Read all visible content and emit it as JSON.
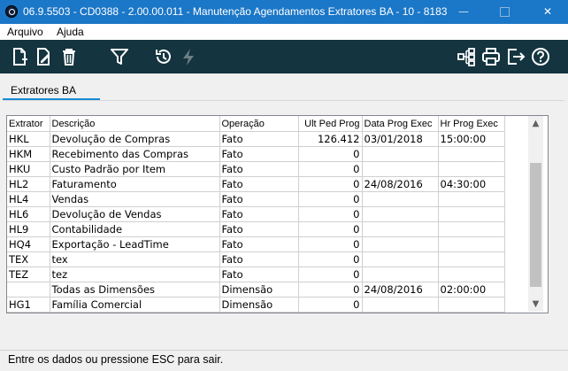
{
  "window": {
    "title": "06.9.5503 - CD0388 - 2.00.00.011 - Manutenção Agendamentos Extratores BA - 10 - 8183",
    "minimize_glyph": "—",
    "close_glyph": "✕"
  },
  "menu": {
    "items": [
      {
        "label": "Arquivo"
      },
      {
        "label": "Ajuda"
      }
    ]
  },
  "toolbar": {
    "icons": [
      "new-document-icon",
      "edit-document-icon",
      "delete-trash-icon",
      "filter-icon",
      "history-icon",
      "lightning-icon",
      "tree-structure-icon",
      "print-icon",
      "exit-icon",
      "help-icon"
    ]
  },
  "tab": {
    "label": "Extratores BA"
  },
  "grid": {
    "columns": [
      "Extrator",
      "Descrição",
      "Operação",
      "Ult Ped Prog",
      "Data Prog Exec",
      "Hr Prog Exec"
    ],
    "rows": [
      [
        "HKL",
        "Devolução de Compras",
        "Fato",
        "126.412",
        "03/01/2018",
        "15:00:00"
      ],
      [
        "HKM",
        "Recebimento das Compras",
        "Fato",
        "0",
        "",
        ""
      ],
      [
        "HKU",
        "Custo Padrão por Item",
        "Fato",
        "0",
        "",
        ""
      ],
      [
        "HL2",
        "Faturamento",
        "Fato",
        "0",
        "24/08/2016",
        "04:30:00"
      ],
      [
        "HL4",
        "Vendas",
        "Fato",
        "0",
        "",
        ""
      ],
      [
        "HL6",
        "Devolução de Vendas",
        "Fato",
        "0",
        "",
        ""
      ],
      [
        "HL9",
        "Contabilidade",
        "Fato",
        "0",
        "",
        ""
      ],
      [
        "HQ4",
        "Exportação - LeadTime",
        "Fato",
        "0",
        "",
        ""
      ],
      [
        "TEX",
        "tex",
        "Fato",
        "0",
        "",
        ""
      ],
      [
        "TEZ",
        "tez",
        "Fato",
        "0",
        "",
        ""
      ],
      [
        "",
        "Todas as Dimensões",
        "Dimensão",
        "0",
        "24/08/2016",
        "02:00:00"
      ],
      [
        "HG1",
        "Família Comercial",
        "Dimensão",
        "0",
        "",
        ""
      ]
    ]
  },
  "scrollbar": {
    "up_glyph": "▲",
    "down_glyph": "▼"
  },
  "status": {
    "text": "Entre os dados ou pressione ESC para sair."
  },
  "colors": {
    "title_bar": "#1b77c7",
    "toolbar": "#14343f",
    "tab_accent": "#1b8bd6"
  }
}
